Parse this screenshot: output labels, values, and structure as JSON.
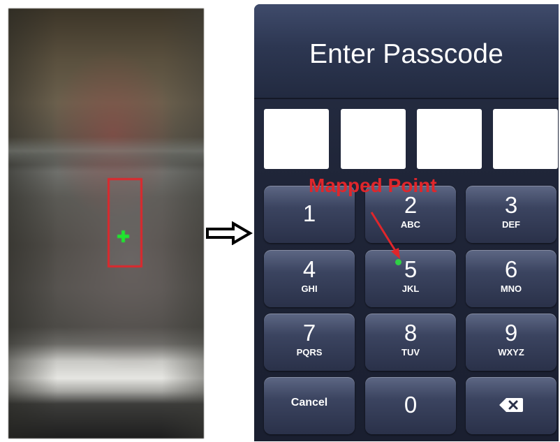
{
  "camera_frame": {
    "tracking_box_color": "#e0262b",
    "fingertip_marker_color": "#1ee62e"
  },
  "flow_arrow": {
    "icon": "right-arrow-icon"
  },
  "passcode_screen": {
    "title": "Enter Passcode",
    "pin_boxes": [
      "",
      "",
      "",
      ""
    ],
    "keys": [
      {
        "digit": "1",
        "letters": ""
      },
      {
        "digit": "2",
        "letters": "ABC"
      },
      {
        "digit": "3",
        "letters": "DEF"
      },
      {
        "digit": "4",
        "letters": "GHI"
      },
      {
        "digit": "5",
        "letters": "JKL"
      },
      {
        "digit": "6",
        "letters": "MNO"
      },
      {
        "digit": "7",
        "letters": "PQRS"
      },
      {
        "digit": "8",
        "letters": "TUV"
      },
      {
        "digit": "9",
        "letters": "WXYZ"
      },
      {
        "label": "Cancel"
      },
      {
        "digit": "0",
        "letters": ""
      },
      {
        "icon": "delete-backspace-icon"
      }
    ]
  },
  "annotation": {
    "label": "Mapped Point",
    "color": "#e0262b",
    "point_color": "#2fd145"
  }
}
